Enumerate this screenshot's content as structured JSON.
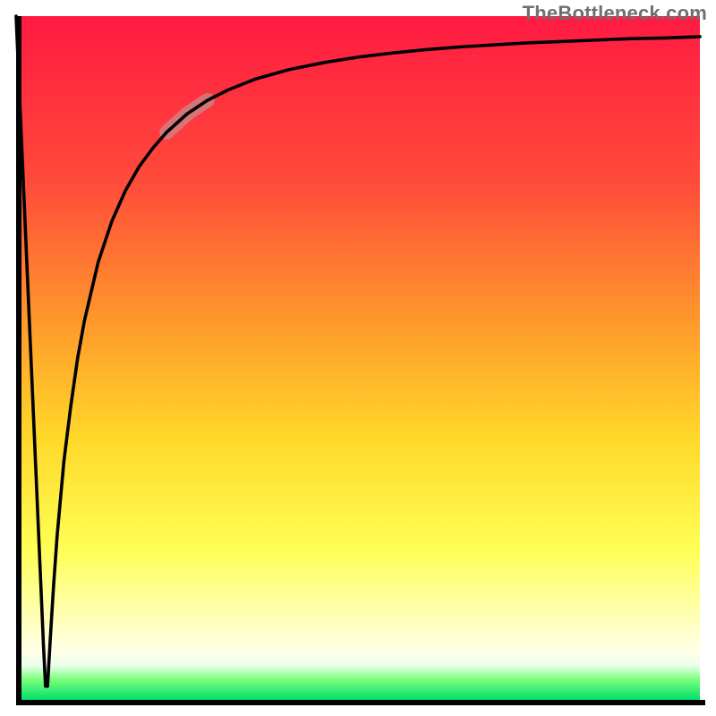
{
  "watermark": "TheBottleneck.com",
  "gradient": {
    "stops": [
      {
        "pct": 0,
        "color": "#ff1a42"
      },
      {
        "pct": 24,
        "color": "#ff4a3a"
      },
      {
        "pct": 45,
        "color": "#ff9a2a"
      },
      {
        "pct": 62,
        "color": "#ffd92a"
      },
      {
        "pct": 78,
        "color": "#ffff55"
      },
      {
        "pct": 89,
        "color": "#ffffc0"
      },
      {
        "pct": 93,
        "color": "#ffffe8"
      },
      {
        "pct": 95,
        "color": "#eaffea"
      },
      {
        "pct": 97,
        "color": "#7cff7c"
      },
      {
        "pct": 100,
        "color": "#00e06a"
      }
    ]
  },
  "curve_style": {
    "stroke": "#000000",
    "width": 3.6
  },
  "highlight_segment": {
    "color": "#c98a8a",
    "opacity": 0.75,
    "width": 16,
    "x_start": 0.205,
    "x_end": 0.3
  },
  "chart_data": {
    "type": "line",
    "title": "",
    "xlabel": "",
    "ylabel": "",
    "xlim": [
      0,
      1
    ],
    "ylim": [
      0,
      1
    ],
    "grid": false,
    "legend": false,
    "annotations": [
      "TheBottleneck.com"
    ],
    "series": [
      {
        "name": "curve",
        "x": [
          0.0,
          0.01,
          0.02,
          0.03,
          0.04,
          0.043,
          0.046,
          0.05,
          0.055,
          0.06,
          0.07,
          0.08,
          0.09,
          0.1,
          0.12,
          0.14,
          0.16,
          0.18,
          0.2,
          0.22,
          0.25,
          0.28,
          0.31,
          0.35,
          0.4,
          0.45,
          0.5,
          0.55,
          0.6,
          0.65,
          0.7,
          0.75,
          0.8,
          0.85,
          0.9,
          0.95,
          1.0
        ],
        "y": [
          1.0,
          0.77,
          0.54,
          0.31,
          0.08,
          0.02,
          0.02,
          0.09,
          0.17,
          0.24,
          0.35,
          0.43,
          0.5,
          0.555,
          0.64,
          0.7,
          0.745,
          0.78,
          0.807,
          0.83,
          0.857,
          0.877,
          0.892,
          0.908,
          0.922,
          0.932,
          0.94,
          0.946,
          0.951,
          0.955,
          0.958,
          0.961,
          0.963,
          0.965,
          0.967,
          0.968,
          0.97
        ]
      }
    ]
  }
}
